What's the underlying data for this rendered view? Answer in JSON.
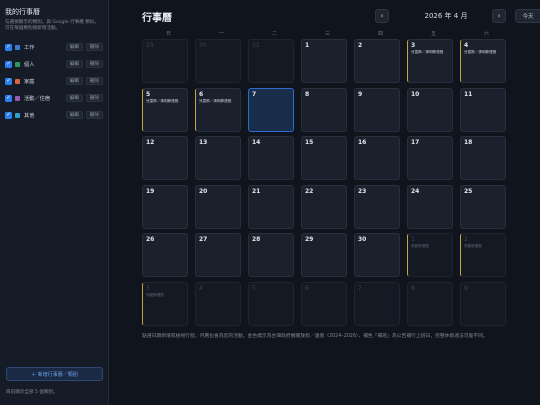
{
  "sidebar": {
    "title": "我的行事曆",
    "description": "勾選要顯示的類別。與 Google 行事曆 類似，可在每個類別裡新增活動。",
    "edit_label": "編輯",
    "delete_label": "刪除",
    "calendars": [
      {
        "name": "工作",
        "checked": true,
        "color": "#3a7bd5"
      },
      {
        "name": "個人",
        "checked": true,
        "color": "#2e9b62"
      },
      {
        "name": "家庭",
        "checked": true,
        "color": "#d9633a"
      },
      {
        "name": "活動／住宿",
        "checked": true,
        "color": "#9b59b6"
      },
      {
        "name": "其他",
        "checked": true,
        "color": "#2aa3c7"
      }
    ],
    "add_button": "＋ 新增行事曆／類別",
    "footer": "目前顯示全部 5 個類別。"
  },
  "header": {
    "title": "行事曆",
    "prev_icon": "‹",
    "next_icon": "›",
    "month_label": "2026 年 4 月",
    "today_button": "今天"
  },
  "weekdays": [
    "日",
    "一",
    "二",
    "三",
    "四",
    "五",
    "六"
  ],
  "weeks": [
    [
      {
        "day": "29",
        "out": true
      },
      {
        "day": "30",
        "out": true
      },
      {
        "day": "31",
        "out": true
      },
      {
        "day": "1"
      },
      {
        "day": "2"
      },
      {
        "day": "3",
        "holiday": true,
        "event": "兒童節／清明節連假"
      },
      {
        "day": "4",
        "holiday": true,
        "event": "兒童節／清明節連假"
      }
    ],
    [
      {
        "day": "5",
        "holiday": true,
        "event": "兒童節／清明節連假"
      },
      {
        "day": "6",
        "holiday": true,
        "event": "兒童節／清明節連假"
      },
      {
        "day": "7",
        "today": true
      },
      {
        "day": "8"
      },
      {
        "day": "9"
      },
      {
        "day": "10"
      },
      {
        "day": "11"
      }
    ],
    [
      {
        "day": "12"
      },
      {
        "day": "13"
      },
      {
        "day": "14"
      },
      {
        "day": "15"
      },
      {
        "day": "16"
      },
      {
        "day": "17"
      },
      {
        "day": "18"
      }
    ],
    [
      {
        "day": "19"
      },
      {
        "day": "20"
      },
      {
        "day": "21"
      },
      {
        "day": "22"
      },
      {
        "day": "23"
      },
      {
        "day": "24"
      },
      {
        "day": "25"
      }
    ],
    [
      {
        "day": "26"
      },
      {
        "day": "27"
      },
      {
        "day": "28"
      },
      {
        "day": "29"
      },
      {
        "day": "30"
      },
      {
        "day": "1",
        "out": true,
        "holiday": true,
        "event": "勞動節連假"
      },
      {
        "day": "2",
        "out": true,
        "holiday": true,
        "event": "勞動節連假"
      }
    ],
    [
      {
        "day": "3",
        "out": true,
        "holiday": true,
        "event": "勞動節連假"
      },
      {
        "day": "4",
        "out": true
      },
      {
        "day": "5",
        "out": true
      },
      {
        "day": "6",
        "out": true
      },
      {
        "day": "7",
        "out": true
      },
      {
        "day": "8",
        "out": true
      },
      {
        "day": "9",
        "out": true
      }
    ]
  ],
  "footnote": "點選日期新增或檢視行程。月曆也會為您的活動。金色標示為台灣政府機關放假／連假（2024–2026），補色「補班」為公告補行上班日，完整休假適法可能不同。",
  "colors": {
    "accent": "#2d7ff0",
    "holiday": "#c9a43e",
    "today": "#182d4a"
  }
}
